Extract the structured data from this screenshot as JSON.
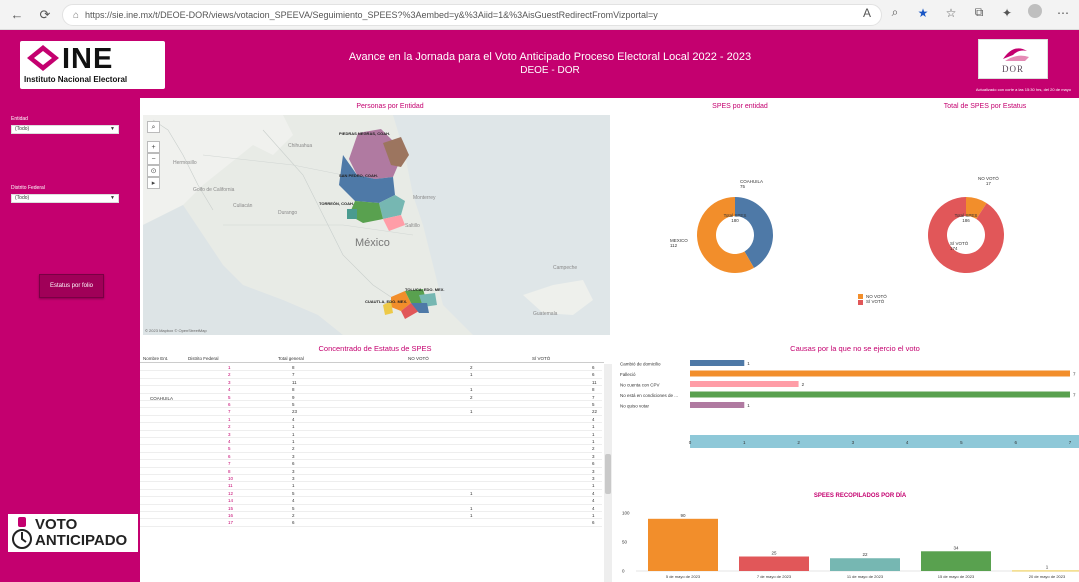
{
  "browser": {
    "url": "https://sie.ine.mx/t/DEOE-DOR/views/votacion_SPEEVA/Seguimiento_SPEES?%3Aembed=y&%3Aiid=1&%3AisGuestRedirectFromVizportal=y",
    "icons": [
      "back-icon",
      "refresh-icon",
      "lock-icon",
      "read-aloud-icon",
      "zoom-icon",
      "favorite-star-icon",
      "favorites-icon",
      "collections-icon",
      "extensions-icon",
      "profile-icon"
    ]
  },
  "header": {
    "ine_word": "INE",
    "ine_sub": "Instituto Nacional Electoral",
    "title_line1": "Avance en la Jornada  para el Voto Anticipado Proceso Electoral Local 2022 - 2023",
    "title_line2": "DEOE - DOR",
    "dor_text": "DOR",
    "updated": "Actualizado con corte a las 15:30 hrs, del 20 de mayo"
  },
  "sidebar": {
    "filter1_label": "Entidad",
    "filter1_value": "(Todo)",
    "filter2_label": "Distrito Federal",
    "filter2_value": "(Todo)",
    "button_label": "Estatus por folio",
    "voto_l1": "VOTO",
    "voto_l2": "ANTICIPADO"
  },
  "sections": {
    "map_title": "Personas por Entidad",
    "spes_entidad_title": "SPES por entidad",
    "spes_estatus_title": "Total de SPES por Estatus",
    "table_title": "Concentrado de Estatus de SPES",
    "causes_title": "Causas por la que no se ejercio el voto",
    "recop_title": "SPEES RECOPILADOS POR DÍA"
  },
  "map": {
    "labels": {
      "country": "México",
      "chihuahua": "Chihuahua",
      "monterrey": "Monterrey",
      "durango": "Durango",
      "torreon": "Torreón",
      "hermosillo": "Hermosillo",
      "culiacan": "Culiacán",
      "saltillo": "Saltillo",
      "golfo": "Golfo de California",
      "campeche": "Campeche",
      "guatemala": "Guatemala",
      "r1": "PIEDRAS NEGRAS, COAH.",
      "r2": "SAN PEDRO, COAH.",
      "r3": "TORREÓN, COAH.",
      "r4": "CUAUTLA, EDO. MEX.",
      "r5": "TOLUCA, EDO. MEX."
    },
    "credit": "© 2023 Mapbox © OpenStreetMap",
    "controls": [
      "search-icon",
      "zoom-in-icon",
      "zoom-out-icon",
      "home-icon",
      "play-icon"
    ]
  },
  "donut_entidad": {
    "center_label": "Total SPES",
    "center_value": "180",
    "label_a": "COAHUILA",
    "value_a": "75",
    "label_b": "MEXICO",
    "value_b": "112",
    "segments": [
      {
        "name": "COAHUILA",
        "value": 75,
        "color": "#4e79a7"
      },
      {
        "name": "MEXICO",
        "value": 105,
        "color": "#f28e2b"
      }
    ]
  },
  "donut_estatus": {
    "center_label": "Total SPES",
    "center_value": "186",
    "label_a": "NO VOTÓ",
    "value_a": "17",
    "label_b": "SÍ VOTÓ",
    "value_b": "174",
    "segments": [
      {
        "name": "NO VOTÓ",
        "value": 17,
        "color": "#f28e2b"
      },
      {
        "name": "SÍ VOTÓ",
        "value": 169,
        "color": "#e15759"
      }
    ],
    "legend": [
      {
        "label": "NO VOTÓ",
        "color": "#f28e2b"
      },
      {
        "label": "SÍ VOTÓ",
        "color": "#e15759"
      }
    ]
  },
  "table": {
    "headers": [
      "Nombre Ent.",
      "Distrito Federal",
      "Total general",
      "NO VOTÓ",
      "SÍ VOTÓ"
    ],
    "group_label": "COAHUILA",
    "rows": [
      {
        "d": "1",
        "total": "8",
        "no": "2",
        "si": "6"
      },
      {
        "d": "2",
        "total": "7",
        "no": "1",
        "si": "6"
      },
      {
        "d": "3",
        "total": "11",
        "no": "",
        "si": "11"
      },
      {
        "d": "4",
        "total": "8",
        "no": "1",
        "si": "8"
      },
      {
        "d": "5",
        "total": "9",
        "no": "2",
        "si": "7"
      },
      {
        "d": "6",
        "total": "5",
        "no": "",
        "si": "5"
      },
      {
        "d": "7",
        "total": "23",
        "no": "1",
        "si": "22"
      },
      {
        "d": "1",
        "total": "4",
        "no": "",
        "si": "4"
      },
      {
        "d": "2",
        "total": "1",
        "no": "",
        "si": "1"
      },
      {
        "d": "3",
        "total": "1",
        "no": "",
        "si": "1"
      },
      {
        "d": "4",
        "total": "1",
        "no": "",
        "si": "1"
      },
      {
        "d": "5",
        "total": "2",
        "no": "",
        "si": "2"
      },
      {
        "d": "6",
        "total": "3",
        "no": "",
        "si": "3"
      },
      {
        "d": "7",
        "total": "6",
        "no": "",
        "si": "6"
      },
      {
        "d": "8",
        "total": "3",
        "no": "",
        "si": "3"
      },
      {
        "d": "10",
        "total": "3",
        "no": "",
        "si": "3"
      },
      {
        "d": "11",
        "total": "1",
        "no": "",
        "si": "1"
      },
      {
        "d": "12",
        "total": "5",
        "no": "1",
        "si": "4"
      },
      {
        "d": "14",
        "total": "4",
        "no": "",
        "si": "4"
      },
      {
        "d": "15",
        "total": "5",
        "no": "1",
        "si": "4"
      },
      {
        "d": "16",
        "total": "2",
        "no": "1",
        "si": "1"
      },
      {
        "d": "17",
        "total": "6",
        "no": "",
        "si": "6"
      }
    ]
  },
  "chart_data": [
    {
      "type": "pie",
      "title": "SPES por entidad",
      "labels": [
        "COAHUILA",
        "MEXICO"
      ],
      "values": [
        75,
        112
      ],
      "center_label": "Total SPES 180"
    },
    {
      "type": "pie",
      "title": "Total de SPES por Estatus",
      "labels": [
        "NO VOTÓ",
        "SÍ VOTÓ"
      ],
      "values": [
        17,
        174
      ],
      "center_label": "Total SPES 186"
    },
    {
      "type": "bar",
      "orientation": "horizontal",
      "title": "Causas por la que no se ejercio el voto",
      "categories": [
        "Cambió de domicilio",
        "Falleció",
        "No cuenta con CPV",
        "No está en condiciones de ...",
        "No quiso votar"
      ],
      "values": [
        1,
        7,
        2,
        7,
        1
      ],
      "colors": [
        "#4e79a7",
        "#f28e2b",
        "#ff9da7",
        "#59a14f",
        "#b07aa1"
      ],
      "xlim": [
        0,
        7
      ],
      "xticks": [
        "0",
        "1",
        "2",
        "3",
        "4",
        "5",
        "6",
        "7"
      ]
    },
    {
      "type": "bar",
      "title": "SPEES RECOPILADOS POR DÍA",
      "categories": [
        "5 de mayo de 2023",
        "7 de mayo de 2023",
        "11 de mayo de 2023",
        "15 de mayo de 2023",
        "20 de mayo de 2023"
      ],
      "values": [
        90,
        25,
        22,
        34,
        1
      ],
      "colors": [
        "#f28e2b",
        "#e15759",
        "#76b7b2",
        "#59a14f",
        "#edc948"
      ],
      "ylim": [
        0,
        100
      ],
      "yticks": [
        "0",
        "50",
        "100"
      ]
    }
  ]
}
